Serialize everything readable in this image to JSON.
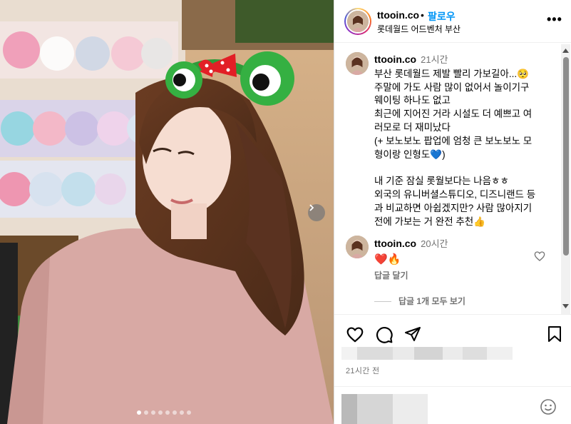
{
  "post": {
    "username": "ttooin.co",
    "dot": "•",
    "follow_label": "팔로우",
    "location": "롯데월드 어드벤처 부산",
    "more_label": "•••"
  },
  "caption": {
    "username": "ttooin.co",
    "time": "21시간",
    "lines": [
      "부산 롯데월드 제발 빨리 가보길아...🥺",
      "주말에 가도 사람 많이 없어서 놀이기구",
      "웨이팅 하나도 없고",
      "최근에 지어진 거라 시설도 더 예쁘고 여",
      "러모로 더 재미났다",
      "(+ 보노보노 팝업에 엄청 큰 보노보노 모",
      "형이랑 인형도💙)",
      "",
      "내 기준 잠실 롯월보다는 나음ㅎㅎ",
      "외국의 유니버셜스튜디오, 디즈니랜드 등",
      "과 비교하면 아쉽겠지만? 사람 많아지기",
      "전에 가보는 거 완전 추천👍"
    ]
  },
  "comment": {
    "username": "ttooin.co",
    "time": "20시간",
    "text": "❤️🔥",
    "reply_label": "답글 달기",
    "view_replies_label": "답글 1개 모두 보기"
  },
  "actions": {
    "icons": [
      "heart-icon",
      "comment-icon",
      "share-icon",
      "bookmark-icon"
    ],
    "post_time": "21시간 전"
  },
  "carousel": {
    "total_images": 8,
    "active_index": 0
  },
  "colors": {
    "accent": "#0095f6",
    "secondary_text": "#737373",
    "border": "#dbdbdb"
  }
}
